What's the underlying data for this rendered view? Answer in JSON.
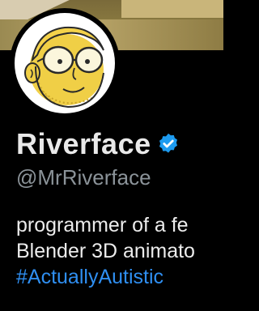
{
  "profile": {
    "display_name": "Riverface",
    "handle": "@MrRiverface",
    "bio_line_1": "programmer of a fe",
    "bio_line_2": "Blender 3D animato",
    "bio_hashtag": "#ActuallyAutistic"
  },
  "colors": {
    "background": "#000000",
    "name": "#e9e9e9",
    "handle": "#8b9399",
    "hashtag": "#2f8ff2",
    "verified_badge": "#1d9bf0"
  },
  "icons": {
    "verified": "verified-badge-icon"
  }
}
